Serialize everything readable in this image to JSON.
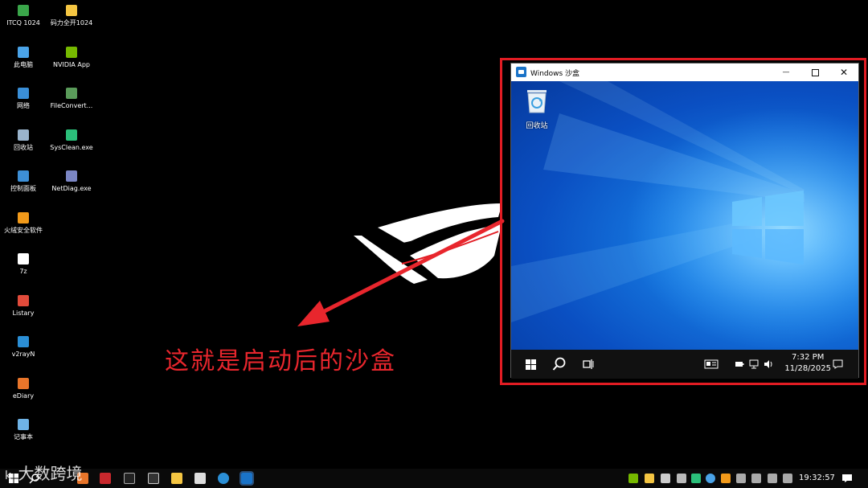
{
  "desktop_icons": [
    {
      "label": "ITCQ 1024",
      "icon": "user-icon",
      "color": "#3aa64a"
    },
    {
      "label": "码力全开1024",
      "icon": "folder-icon",
      "color": "#f4c542"
    },
    {
      "label": "此电脑",
      "icon": "computer-icon",
      "color": "#4aa3e8"
    },
    {
      "label": "NVIDIA App",
      "icon": "nvidia-icon",
      "color": "#76b900"
    },
    {
      "label": "网络",
      "icon": "network-icon",
      "color": "#3a8fd8"
    },
    {
      "label": "FileConvert...",
      "icon": "file-convert-icon",
      "color": "#5a9b5a"
    },
    {
      "label": "回收站",
      "icon": "recycle-bin-icon",
      "color": "#9ab4cc"
    },
    {
      "label": "SysClean.exe",
      "icon": "sysclean-icon",
      "color": "#2bbf7a"
    },
    {
      "label": "控制面板",
      "icon": "control-panel-icon",
      "color": "#3d8fd6"
    },
    {
      "label": "NetDiag.exe",
      "icon": "netdiag-icon",
      "color": "#7b86c4"
    },
    {
      "label": "火绒安全软件",
      "icon": "huorong-icon",
      "color": "#f29a1a"
    },
    {
      "label": "7z",
      "icon": "7zip-icon",
      "color": "#ffffff"
    },
    {
      "label": "Listary",
      "icon": "listary-icon",
      "color": "#e14b3b"
    },
    {
      "label": "v2rayN",
      "icon": "v2rayn-icon",
      "color": "#2b8fd6"
    },
    {
      "label": "eDiary",
      "icon": "ediary-icon",
      "color": "#e8752a"
    },
    {
      "label": "记事本",
      "icon": "notepad-icon",
      "color": "#6fb3e6"
    }
  ],
  "annotation": {
    "text": "这就是启动后的沙盒",
    "color": "#e8262d"
  },
  "sandbox": {
    "title": "Windows 沙盒",
    "minimize": "—",
    "close": "✕",
    "recycle_bin_label": "回收站",
    "clock_time": "7:32 PM",
    "clock_date": "11/28/2025",
    "wallpaper_accent": "#1679e0"
  },
  "host_taskbar": {
    "clock": "19:32:57"
  },
  "watermark": {
    "text": "大数跨境",
    "logo": "k"
  }
}
